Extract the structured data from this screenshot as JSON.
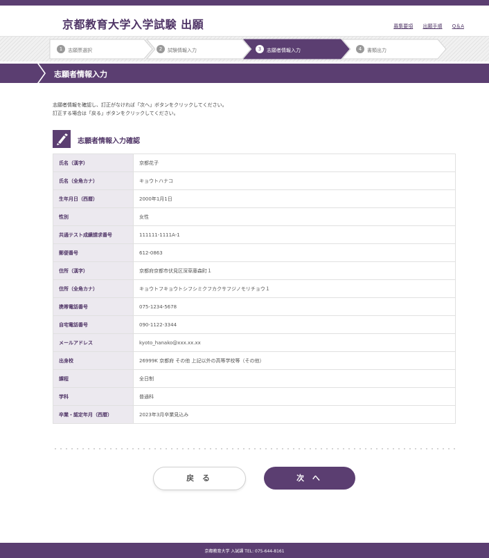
{
  "header": {
    "title": "京都教育大学入学試験 出願",
    "links": [
      "募集要項",
      "出願手順",
      "Q＆A"
    ]
  },
  "steps": [
    {
      "num": "1",
      "label": "志願票選択"
    },
    {
      "num": "2",
      "label": "試験情報入力"
    },
    {
      "num": "3",
      "label": "志願者情報入力"
    },
    {
      "num": "4",
      "label": "書類出力"
    }
  ],
  "active_step": 3,
  "section": {
    "title": "志願者情報入力"
  },
  "instructions": [
    "志願者情報を確認し、訂正がなければ「次へ」ボタンをクリックしてください。",
    "訂正する場合は「戻る」ボタンをクリックしてください。"
  ],
  "confirm": {
    "title": "志願者情報入力確認",
    "rows": [
      {
        "label": "氏名（漢字）",
        "value": "京都花子"
      },
      {
        "label": "氏名（全角カナ）",
        "value": "キョウトハナコ"
      },
      {
        "label": "生年月日（西暦）",
        "value": "2000年1月1日"
      },
      {
        "label": "性別",
        "value": "女性"
      },
      {
        "label": "共通テスト成績請求番号",
        "value": "111111-1111A-1"
      },
      {
        "label": "郵便番号",
        "value": "612-0863"
      },
      {
        "label": "住所（漢字）",
        "value": "京都府京都市伏見区深草藤森町１"
      },
      {
        "label": "住所（全角カナ）",
        "value": "キョウトフキョウトシフシミクフカクサフジノモリチョウ１"
      },
      {
        "label": "携帯電話番号",
        "value": "075-1234-5678"
      },
      {
        "label": "自宅電話番号",
        "value": "090-1122-3344"
      },
      {
        "label": "メールアドレス",
        "value": "kyoto_hanako@xxx.xx.xx"
      },
      {
        "label": "出身校",
        "value": "26999K 京都府 その他 上記以外の高等学校等（その他）"
      },
      {
        "label": "課程",
        "value": "全日制"
      },
      {
        "label": "学科",
        "value": "普通科"
      },
      {
        "label": "卒業・認定年月（西暦）",
        "value": "2023年3月卒業見込み"
      }
    ]
  },
  "buttons": {
    "back": "戻 る",
    "next": "次 へ"
  },
  "footer": {
    "text": "京都教育大学 入試課 TEL: 075-644-8161"
  },
  "colors": {
    "accent": "#5b3e71",
    "label_bg": "#ece9ef"
  }
}
